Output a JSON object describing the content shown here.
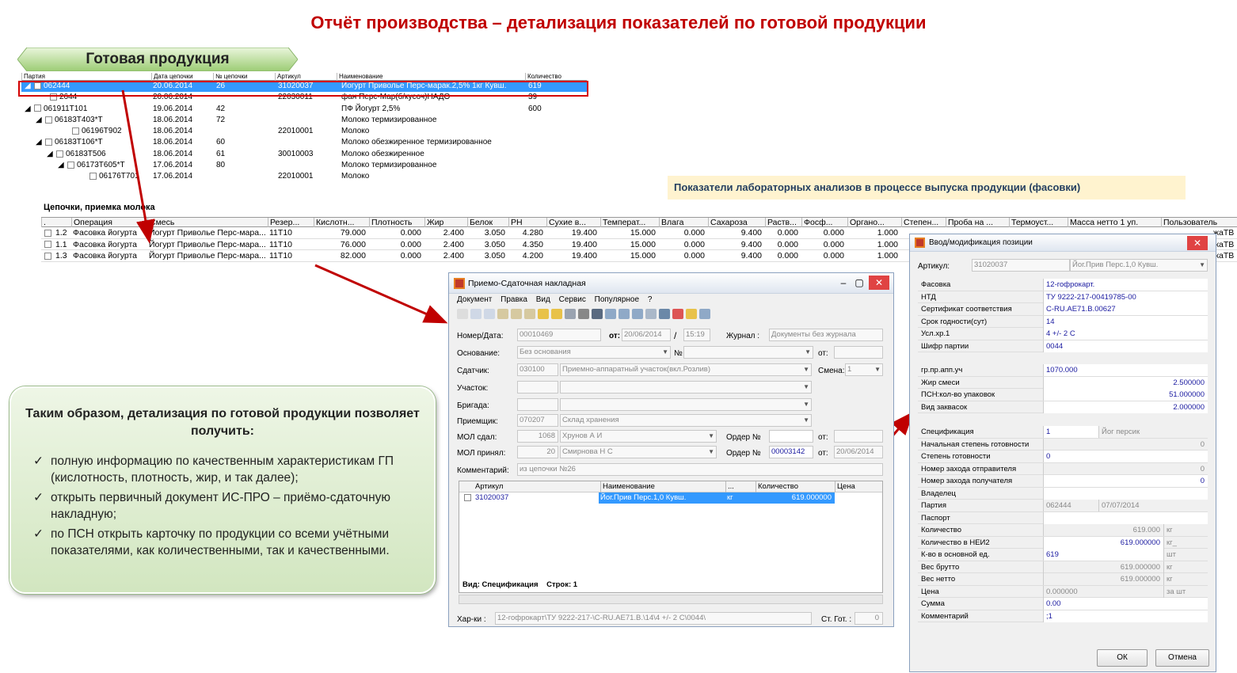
{
  "title": "Отчёт производства – детализация показателей по готовой продукции",
  "section_label": "Готовая продукция",
  "tree": {
    "headers": [
      "Партия",
      "Дата цепочки",
      "№ цепочки",
      "Артикул",
      "Наименование",
      "Количество"
    ],
    "rows": [
      {
        "tog": "◢",
        "party": "062444",
        "date": "20.06.2014",
        "chain": "26",
        "art": "31020037",
        "name": "Йогурт Приволье Перс-марак.2,5% 1кг Кувш.",
        "qty": "619"
      },
      {
        "tog": "",
        "party": "2644",
        "date": "20.06.2014",
        "chain": "",
        "art": "22030011",
        "name": "фан Перс-Мар(б/кусоч)НАДО",
        "qty": "39"
      },
      {
        "tog": "◢",
        "party": "061911Т101",
        "date": "19.06.2014",
        "chain": "42",
        "art": "",
        "name": "ПФ Йогурт 2,5%",
        "qty": "600"
      },
      {
        "tog": "◢",
        "party": "06183Т403*Т",
        "date": "18.06.2014",
        "chain": "72",
        "art": "",
        "name": "Молоко термизированное",
        "qty": ""
      },
      {
        "tog": "",
        "party": "06196Т902",
        "date": "18.06.2014",
        "chain": "",
        "art": "22010001",
        "name": "Молоко",
        "qty": ""
      },
      {
        "tog": "◢",
        "party": "06183Т106*Т",
        "date": "18.06.2014",
        "chain": "60",
        "art": "",
        "name": "Молоко обезжиренное термизированное",
        "qty": ""
      },
      {
        "tog": "◢",
        "party": "06183Т506",
        "date": "18.06.2014",
        "chain": "61",
        "art": "30010003",
        "name": "Молоко обезжиренное",
        "qty": ""
      },
      {
        "tog": "◢",
        "party": "06173Т605*Т",
        "date": "17.06.2014",
        "chain": "80",
        "art": "",
        "name": "Молоко термизированное",
        "qty": ""
      },
      {
        "tog": "",
        "party": "06176Т701",
        "date": "17.06.2014",
        "chain": "",
        "art": "22010001",
        "name": "Молоко",
        "qty": ""
      }
    ]
  },
  "chains": {
    "label": "Цепочки, приемка молока",
    "lab_note": "Показатели лабораторных анализов в процессе выпуска продукции (фасовки)",
    "headers": [
      ".",
      "Операция",
      "Смесь",
      "Резер...",
      "Кислотн...",
      "Плотность",
      "Жир",
      "Белок",
      "PH",
      "Сухие в...",
      "Температ...",
      "Влага",
      "Сахароза",
      "Раств...",
      "Фосф...",
      "Органо...",
      "Степен...",
      "Проба на ...",
      "Термоуст...",
      "Масса нетто 1 уп.",
      "Пользователь"
    ],
    "rows": [
      [
        "1.2",
        "Фасовка йогурта",
        "Йогурт Приволье Перс-мара...",
        "11Т10",
        "79.000",
        "0.000",
        "2.400",
        "3.050",
        "4.280",
        "19.400",
        "15.000",
        "0.000",
        "9.400",
        "0.000",
        "0.000",
        "1.000"
      ],
      [
        "1.1",
        "Фасовка йогурта",
        "Йогурт Приволье Перс-мара...",
        "11Т10",
        "76.000",
        "0.000",
        "2.400",
        "3.050",
        "4.350",
        "19.400",
        "15.000",
        "0.000",
        "9.400",
        "0.000",
        "0.000",
        "1.000"
      ],
      [
        "1.3",
        "Фасовка йогурта",
        "Йогурт Приволье Перс-мара...",
        "11Т10",
        "82.000",
        "0.000",
        "2.400",
        "3.050",
        "4.200",
        "19.400",
        "15.000",
        "0.000",
        "9.400",
        "0.000",
        "0.000",
        "1.000"
      ]
    ],
    "right_tail": [
      "жаТВ",
      "жаТВ",
      "жаТВ"
    ]
  },
  "summary": {
    "heading": "Таким образом, детализация по готовой продукции позволяет получить:",
    "items": [
      "полную информацию по качественным характеристикам ГП (кислотность, плотность, жир, и так далее);",
      "открыть первичный документ ИС-ПРО – приёмо-сдаточную накладную;",
      "по ПСН открыть карточку по продукции со всеми учётными показателями, как количественными, так и качественными."
    ]
  },
  "invoice": {
    "title": "Приемо-Сдаточная накладная",
    "menu": [
      "Документ",
      "Правка",
      "Вид",
      "Сервис",
      "Популярное",
      "?"
    ],
    "num_label": "Номер/Дата:",
    "num": "00010469",
    "from_label": "от:",
    "date": "20/06/2014",
    "slash": "/",
    "time": "15:19",
    "journal_label": "Журнал :",
    "journal": "Документы без журнала",
    "basis_label": "Основание:",
    "basis": "Без основания",
    "no_label": "№",
    "from2_label": "от:",
    "sender_label": "Сдатчик:",
    "sender_code": "030100",
    "sender": "Приемно-аппаратный участок(вкл.Розлив)",
    "shift_label": "Смена:",
    "shift": "1",
    "area_label": "Участок:",
    "brigade_label": "Бригада:",
    "receiver_label": "Приемщик:",
    "receiver_code": "070207",
    "receiver": "Склад хранения",
    "mol_gave_label": "МОЛ сдал:",
    "mol_gave_code": "1068",
    "mol_gave": "Хрунов А И",
    "order_label": "Ордер №",
    "from3_label": "от:",
    "mol_got_label": "МОЛ принял:",
    "mol_got_code": "20",
    "mol_got": "Смирнова Н С",
    "order2_label": "Ордер №",
    "order2": "00003142",
    "from4_label": "от:",
    "date2": "20/06/2014",
    "comment_label": "Комментарий:",
    "comment": "из цепочки №26",
    "grid_headers": [
      "Артикул",
      "Наименование",
      "...",
      "Количество",
      "Цена"
    ],
    "grid_row": {
      "art": "31020037",
      "name": "Йог.Прив Перс.1,0 Кувш.",
      "unit": "кг",
      "qty": "619.000000"
    },
    "footer_view": "Вид: Спецификация",
    "footer_rows": "Строк: 1",
    "char_label": "Хар-ки :",
    "char": "12-гофрокарт\\ТУ 9222-217-\\C-RU.AE71.B.\\14\\4 +/- 2 C\\0044\\",
    "stage_label": "Ст. Гот. :",
    "stage": "0"
  },
  "item": {
    "title": "Ввод/модификация позиции",
    "art_label": "Артикул:",
    "art": "31020037",
    "art_name": "Йог.Прив Перс.1,0 Кувш.",
    "rows1": [
      [
        "Фасовка",
        "12-гофрокарт."
      ],
      [
        "НТД",
        "ТУ 9222-217-00419785-00"
      ],
      [
        "Сертификат соответствия",
        "C-RU.AE71.B.00627"
      ],
      [
        "Срок годности(сут)",
        "14"
      ],
      [
        "Усл.хр.1",
        "4 +/- 2 C"
      ],
      [
        "Шифр партии",
        "0044"
      ]
    ],
    "rows2": [
      [
        "гр.пр.апп.уч",
        "1070.000"
      ],
      [
        "Жир смеси",
        "2.500000"
      ],
      [
        "ПСН:кол-во упаковок",
        "51.000000"
      ],
      [
        "Вид заквасок",
        "2.000000"
      ]
    ],
    "rows3": [
      [
        "Спецификация",
        "1",
        "Йог персик"
      ],
      [
        "Начальная степень готовности",
        "0",
        ""
      ],
      [
        "Степень готовности",
        "0",
        ""
      ],
      [
        "Номер захода отправителя",
        "0",
        ""
      ],
      [
        "Номер захода получателя",
        "0",
        ""
      ],
      [
        "Владелец",
        "",
        ""
      ],
      [
        "Партия",
        "062444",
        "07/07/2014"
      ],
      [
        "Паспорт",
        "",
        ""
      ],
      [
        "Количество",
        "619.000",
        "кг"
      ],
      [
        "Количество в НЕИ2",
        "619.000000",
        "кг_"
      ],
      [
        "К-во в основной ед.",
        "619",
        "шт"
      ],
      [
        "Вес брутто",
        "619.000000",
        "кг"
      ],
      [
        "Вес нетто",
        "619.000000",
        "кг"
      ],
      [
        "Цена",
        "0.000000",
        "за шт"
      ],
      [
        "Сумма",
        "0.00",
        ""
      ],
      [
        "Комментарий",
        ";1",
        ""
      ]
    ],
    "ok": "ОК",
    "cancel": "Отмена"
  }
}
